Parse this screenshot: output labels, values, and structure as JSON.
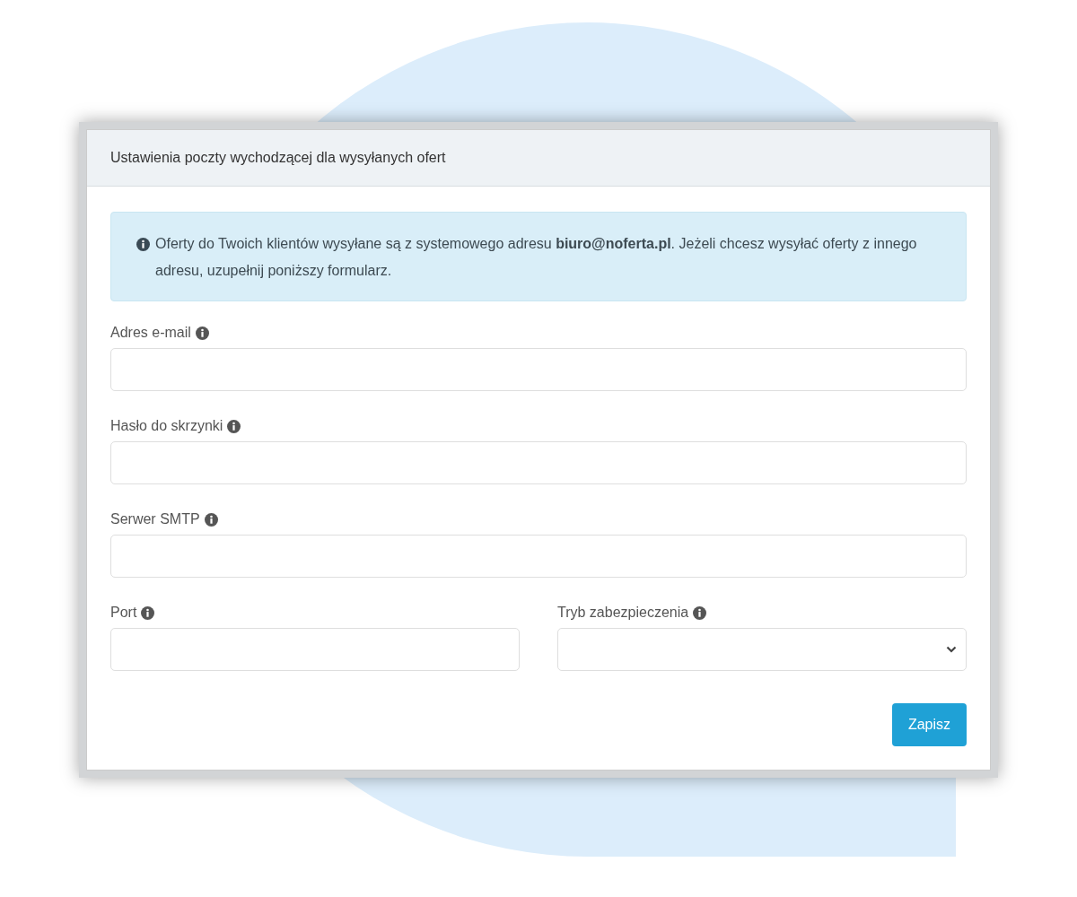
{
  "panel": {
    "title": "Ustawienia poczty wychodzącej dla wysyłanych ofert"
  },
  "info": {
    "text": "Oferty do Twoich klientów wysyłane są z systemowego adresu **biuro@noferta.pl**. Jeżeli chcesz wysyłać oferty z innego adresu, uzupełnij poniższy formularz."
  },
  "rows": [
    [
      {
        "label": "Adres e-mail",
        "kind": "text"
      }
    ],
    [
      {
        "label": "Hasło do skrzynki",
        "kind": "password"
      }
    ],
    [
      {
        "label": "Serwer SMTP",
        "kind": "text"
      }
    ],
    [
      {
        "label": "Port",
        "kind": "text"
      },
      {
        "label": "Tryb zabezpieczenia",
        "kind": "select"
      }
    ]
  ],
  "save_button": {
    "label": "Zapisz"
  }
}
